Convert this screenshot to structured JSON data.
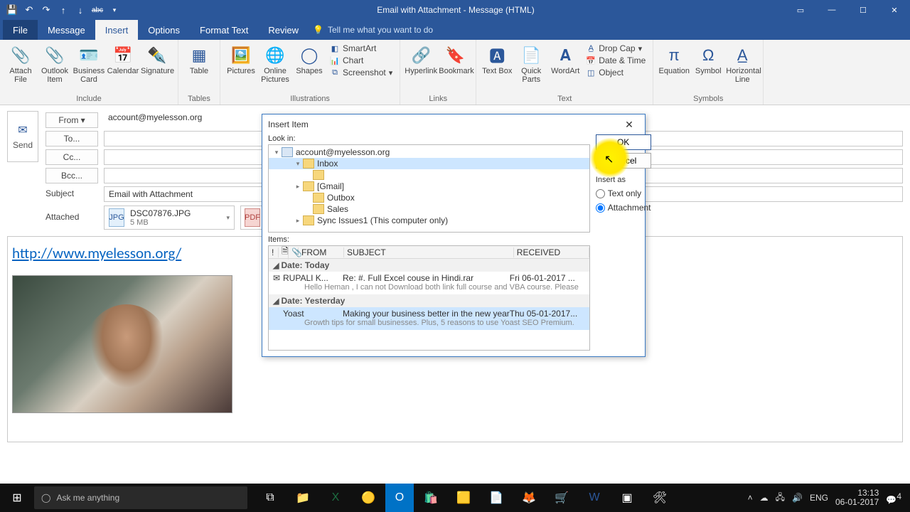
{
  "titlebar": {
    "title": "Email with Attachment  -  Message (HTML)"
  },
  "tabs": {
    "file": "File",
    "message": "Message",
    "insert": "Insert",
    "options": "Options",
    "format": "Format Text",
    "review": "Review",
    "tell": "Tell me what you want to do"
  },
  "ribbon": {
    "include": {
      "label": "Include",
      "attach": "Attach File",
      "outlook": "Outlook Item",
      "biz": "Business Card",
      "cal": "Calendar",
      "sig": "Signature"
    },
    "tables": {
      "label": "Tables",
      "table": "Table"
    },
    "ill": {
      "label": "Illustrations",
      "pics": "Pictures",
      "online": "Online Pictures",
      "shapes": "Shapes",
      "smart": "SmartArt",
      "chart": "Chart",
      "shot": "Screenshot"
    },
    "links": {
      "label": "Links",
      "hyper": "Hyperlink",
      "book": "Bookmark"
    },
    "text": {
      "label": "Text",
      "box": "Text Box",
      "quick": "Quick Parts",
      "word": "WordArt",
      "drop": "Drop Cap",
      "date": "Date & Time",
      "obj": "Object"
    },
    "sym": {
      "label": "Symbols",
      "eq": "Equation",
      "sym": "Symbol",
      "hl": "Horizontal Line"
    }
  },
  "compose": {
    "send": "Send",
    "fromlbl": "From",
    "from": "account@myelesson.org",
    "to": "To...",
    "cc": "Cc...",
    "bcc": "Bcc...",
    "subjlbl": "Subject",
    "subject": "Email with Attachment",
    "attlbl": "Attached",
    "att1name": "DSC07876.JPG",
    "att1size": "5 MB"
  },
  "bodylink": "http://www.myelesson.org/",
  "dialog": {
    "title": "Insert Item",
    "lookin": "Look in:",
    "tree": {
      "acct": "account@myelesson.org",
      "inbox": "Inbox",
      "gmail": "[Gmail]",
      "outbox": "Outbox",
      "sales": "Sales",
      "sync": "Sync Issues1 (This computer only)"
    },
    "ok": "OK",
    "cancel": "Cancel",
    "insertas": "Insert as",
    "textonly": "Text only",
    "attachment": "Attachment",
    "itemslbl": "Items:",
    "hdr": {
      "from": "FROM",
      "subj": "SUBJECT",
      "recv": "RECEIVED"
    },
    "g1": "Date: Today",
    "r1from": "RUPALI K...",
    "r1sub": "Re: #. Full Excel couse in Hindi.rar",
    "r1recv": "Fri 06-01-2017 ...",
    "r1prev": "Hello Heman ,   I can not Download both link full course and VBA course.  Please",
    "g2": "Date: Yesterday",
    "r2from": "Yoast",
    "r2sub": "Making your business better in the new year",
    "r2recv": "Thu 05-01-2017...",
    "r2prev": "Growth tips for small businesses. Plus, 5 reasons to use Yoast SEO Premium."
  },
  "taskbar": {
    "search": "Ask me anything",
    "lang": "ENG",
    "time": "13:13",
    "date": "06-01-2017",
    "notif": "4"
  }
}
